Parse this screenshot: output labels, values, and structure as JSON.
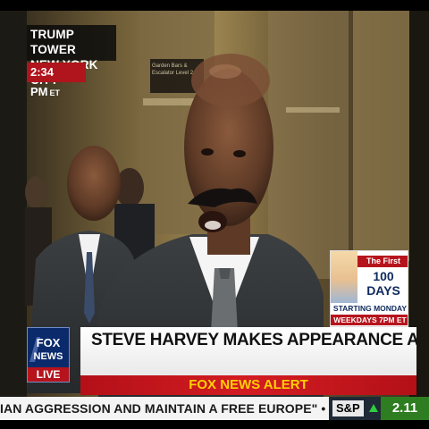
{
  "location": {
    "line1": "TRUMP TOWER",
    "line2": "NEW YORK CITY"
  },
  "time": {
    "clock": "2:34 PM",
    "zone": "ET"
  },
  "sign": {
    "line1": "Garden Bars &",
    "line2": "Escalator Level 2"
  },
  "promo": {
    "line1": "The First",
    "line2": "100 DAYS",
    "line3": "STARTING MONDAY",
    "line4": "WEEKDAYS 7PM ET"
  },
  "logo": {
    "word1": "FOX",
    "word2": "NEWS",
    "live": "LIVE"
  },
  "headline": "STEVE HARVEY MAKES APPEARANCE AT TRUMP TOWER",
  "alert": "FOX NEWS ALERT",
  "ticker": "IAN AGGRESSION AND MAINTAIN A FREE EUROPE\"  •  A SPOX",
  "market": {
    "index": "S&P",
    "value": "2.11",
    "direction": "up"
  },
  "colors": {
    "fox_red": "#b6141d",
    "fox_blue": "#0b2a6b",
    "alert_yellow": "#ffd100",
    "market_green": "#2e7d20"
  }
}
